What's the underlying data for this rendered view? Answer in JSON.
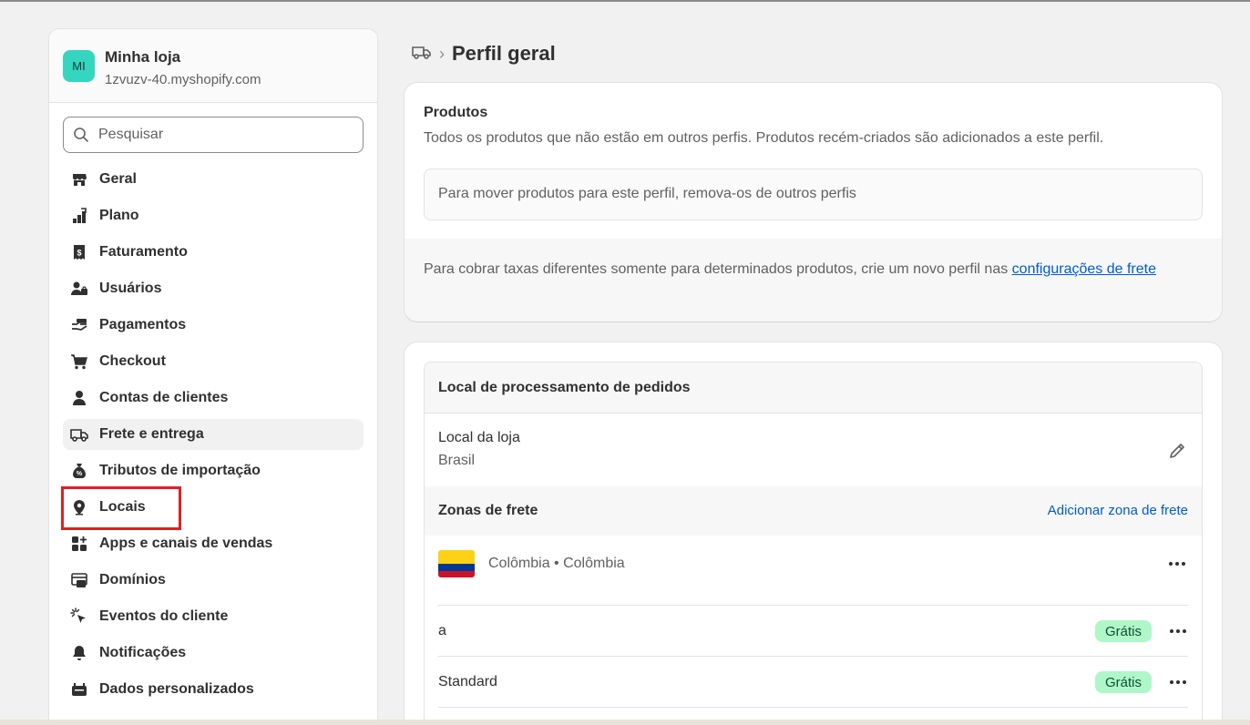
{
  "store": {
    "avatar_initials": "MI",
    "name": "Minha loja",
    "domain": "1zvuzv-40.myshopify.com",
    "avatar_color": "#35d6c0"
  },
  "search": {
    "placeholder": "Pesquisar"
  },
  "nav": {
    "items": [
      {
        "label": "Geral",
        "icon": "store-icon"
      },
      {
        "label": "Plano",
        "icon": "plan-icon"
      },
      {
        "label": "Faturamento",
        "icon": "billing-icon"
      },
      {
        "label": "Usuários",
        "icon": "users-icon"
      },
      {
        "label": "Pagamentos",
        "icon": "payments-icon"
      },
      {
        "label": "Checkout",
        "icon": "cart-icon"
      },
      {
        "label": "Contas de clientes",
        "icon": "person-icon"
      },
      {
        "label": "Frete e entrega",
        "icon": "truck-icon",
        "active": true
      },
      {
        "label": "Tributos de importação",
        "icon": "duties-icon"
      },
      {
        "label": "Locais",
        "icon": "location-icon",
        "highlighted": true
      },
      {
        "label": "Apps e canais de vendas",
        "icon": "apps-icon"
      },
      {
        "label": "Domínios",
        "icon": "domains-icon"
      },
      {
        "label": "Eventos do cliente",
        "icon": "cursor-icon"
      },
      {
        "label": "Notificações",
        "icon": "bell-icon"
      },
      {
        "label": "Dados personalizados",
        "icon": "data-icon"
      }
    ]
  },
  "breadcrumb": {
    "separator": "›",
    "title": "Perfil geral"
  },
  "products": {
    "title": "Produtos",
    "description": "Todos os produtos que não estão em outros perfis. Produtos recém-criados são adicionados a este perfil.",
    "move_note": "Para mover produtos para este perfil, remova-os de outros perfis",
    "footer_text": "Para cobrar taxas diferentes somente para determinados produtos, crie um novo perfil nas ",
    "footer_link": "configurações de frete"
  },
  "fulfillment": {
    "heading": "Local de processamento de pedidos",
    "location_name": "Local da loja",
    "location_country": "Brasil",
    "zones_title": "Zonas de frete",
    "add_zone": "Adicionar zona de frete",
    "zone_name": "Colômbia • Colômbia",
    "rates": [
      {
        "name": "a",
        "price": "Grátis"
      },
      {
        "name": "Standard",
        "price": "Grátis"
      }
    ]
  },
  "colors": {
    "link": "#005bd3",
    "badge_bg": "#aff6c9",
    "highlight": "#e02020"
  }
}
